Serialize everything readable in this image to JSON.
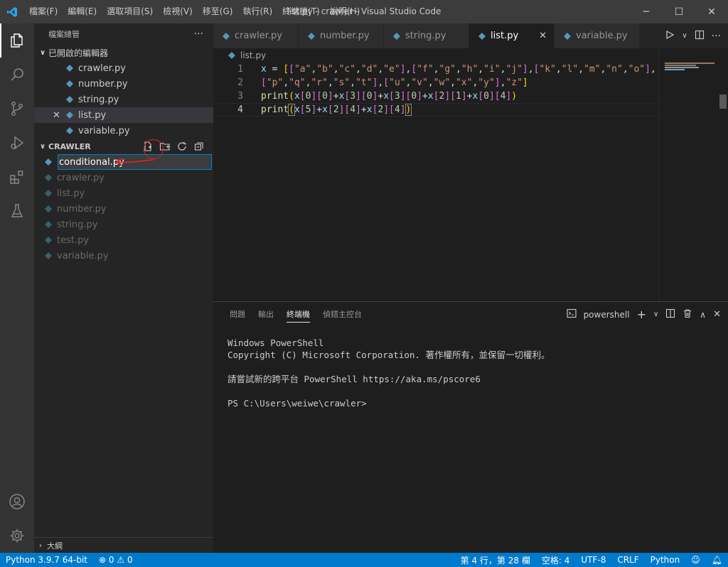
{
  "window": {
    "title": "list.py - crawler - Visual Studio Code",
    "menu": [
      "檔案(F)",
      "編輯(E)",
      "選取項目(S)",
      "檢視(V)",
      "移至(G)",
      "執行(R)",
      "終端機(T)",
      "說明(H)"
    ],
    "controls": {
      "minimize": "─",
      "maximize": "☐",
      "close": "✕"
    }
  },
  "sidebar": {
    "title": "檔案總管",
    "more": "···",
    "open_editors": {
      "label": "已開啟的編輯器",
      "items": [
        "crawler.py",
        "number.py",
        "string.py",
        "list.py",
        "variable.py"
      ]
    },
    "project": {
      "label": "CRAWLER",
      "rename_value": "conditional.py",
      "files": [
        "crawler.py",
        "list.py",
        "number.py",
        "string.py",
        "test.py",
        "variable.py"
      ]
    },
    "outline": "大綱"
  },
  "tabs": {
    "items": [
      "crawler.py",
      "number.py",
      "string.py",
      "list.py",
      "variable.py"
    ],
    "active": "list.py",
    "close": "✕"
  },
  "editor": {
    "breadcrumb": "list.py",
    "line_numbers": [
      "1",
      "2",
      "3",
      "4"
    ]
  },
  "panel": {
    "tabs": [
      "問題",
      "輸出",
      "終端機",
      "偵錯主控台"
    ],
    "shell": "powershell",
    "terminal_lines": [
      "Windows PowerShell",
      "Copyright (C) Microsoft Corporation. 著作權所有，並保留一切權利。",
      "",
      "請嘗試新的跨平台 PowerShell https://aka.ms/pscore6",
      "",
      "PS C:\\Users\\weiwe\\crawler>"
    ]
  },
  "status": {
    "python": "Python 3.9.7 64-bit",
    "errors": "0",
    "warnings": "0",
    "position": "第 4 行，第 28 欄",
    "spaces": "空格: 4",
    "encoding": "UTF-8",
    "eol": "CRLF",
    "language": "Python"
  },
  "colors": {
    "accent": "#007acc",
    "annotation": "#e0232a"
  }
}
